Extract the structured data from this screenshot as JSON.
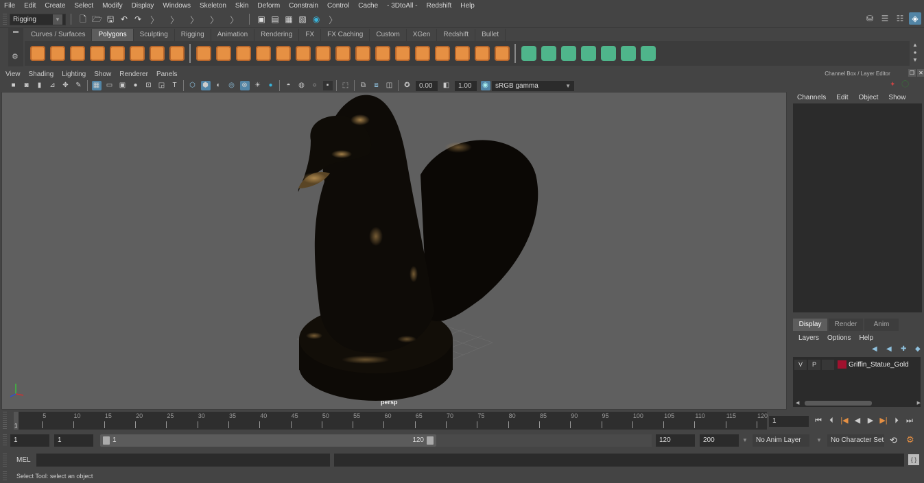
{
  "menubar": [
    "File",
    "Edit",
    "Create",
    "Select",
    "Modify",
    "Display",
    "Windows",
    "Skeleton",
    "Skin",
    "Deform",
    "Constrain",
    "Control",
    "Cache",
    "- 3DtoAll -",
    "Redshift",
    "Help"
  ],
  "status_line": {
    "mode": "Rigging",
    "icons": [
      "new-scene-icon",
      "open-scene-icon",
      "save-scene-icon",
      "undo-icon",
      "redo-icon"
    ],
    "render_icons": [
      "render-view-icon",
      "render-current-frame-icon",
      "ipr-render-icon",
      "render-settings-icon",
      "hypershade-icon"
    ],
    "right_icons": [
      "modeling-toolkit-icon",
      "attribute-editor-icon",
      "tool-settings-icon",
      "channel-box-icon"
    ]
  },
  "shelf": {
    "tabs": [
      "Curves / Surfaces",
      "Polygons",
      "Sculpting",
      "Rigging",
      "Animation",
      "Rendering",
      "FX",
      "FX Caching",
      "Custom",
      "XGen",
      "Redshift",
      "Bullet"
    ],
    "active_tab": "Polygons",
    "primitive_icons": [
      "poly-sphere-icon",
      "poly-cube-icon",
      "poly-cylinder-icon",
      "poly-cone-icon",
      "poly-plane-icon",
      "poly-torus-icon",
      "poly-pyramid-icon",
      "poly-pipe-icon"
    ],
    "tool_icons": [
      "combine-icon",
      "separate-icon",
      "mirror-icon",
      "smooth-icon",
      "extrude-icon",
      "bridge-icon",
      "bevel-icon",
      "multi-cut-icon",
      "target-weld-icon",
      "connect-icon",
      "bevel-edge-icon",
      "insert-edge-loop-icon",
      "offset-edge-loop-icon",
      "quad-draw-icon",
      "fill-hole-icon",
      "merge-icon"
    ],
    "uv_icons": [
      "planar-mapping-icon",
      "cylindrical-mapping-icon",
      "spherical-mapping-icon",
      "automatic-mapping-icon",
      "unfold-icon",
      "uv-editor-icon",
      "cut-sew-icon"
    ]
  },
  "viewport": {
    "menu": [
      "View",
      "Shading",
      "Lighting",
      "Show",
      "Renderer",
      "Panels"
    ],
    "exposure": "0.00",
    "gamma": "1.00",
    "color_space": "sRGB gamma",
    "camera_label": "persp",
    "object_colors": {
      "body": "#0d0a06",
      "highlight": "#b38c50",
      "background": "#5f5f5f"
    }
  },
  "channel_box": {
    "title": "Channel Box / Layer Editor",
    "menu": [
      "Channels",
      "Edit",
      "Object",
      "Show"
    ]
  },
  "layer_editor": {
    "tabs": [
      "Display",
      "Render",
      "Anim"
    ],
    "active_tab": "Display",
    "menu": [
      "Layers",
      "Options",
      "Help"
    ],
    "layers": [
      {
        "visible": "V",
        "playback": "P",
        "color": "#a0112e",
        "name": "Griffin_Statue_Gold"
      }
    ]
  },
  "timeline": {
    "ticks": [
      "5",
      "10",
      "15",
      "20",
      "25",
      "30",
      "35",
      "40",
      "45",
      "50",
      "55",
      "60",
      "65",
      "70",
      "75",
      "80",
      "85",
      "90",
      "95",
      "100",
      "105",
      "110",
      "115",
      "120"
    ],
    "current_frame_marker": "1",
    "current_frame": "1",
    "start": 1,
    "end": 120
  },
  "range": {
    "start_time": "1",
    "playback_start": "1",
    "slider_start": "1",
    "slider_end": "120",
    "playback_end": "120",
    "end_time": "200",
    "anim_layer": "No Anim Layer",
    "character_set": "No Character Set"
  },
  "command_line": {
    "label": "MEL",
    "help_text": "Select Tool: select an object"
  }
}
